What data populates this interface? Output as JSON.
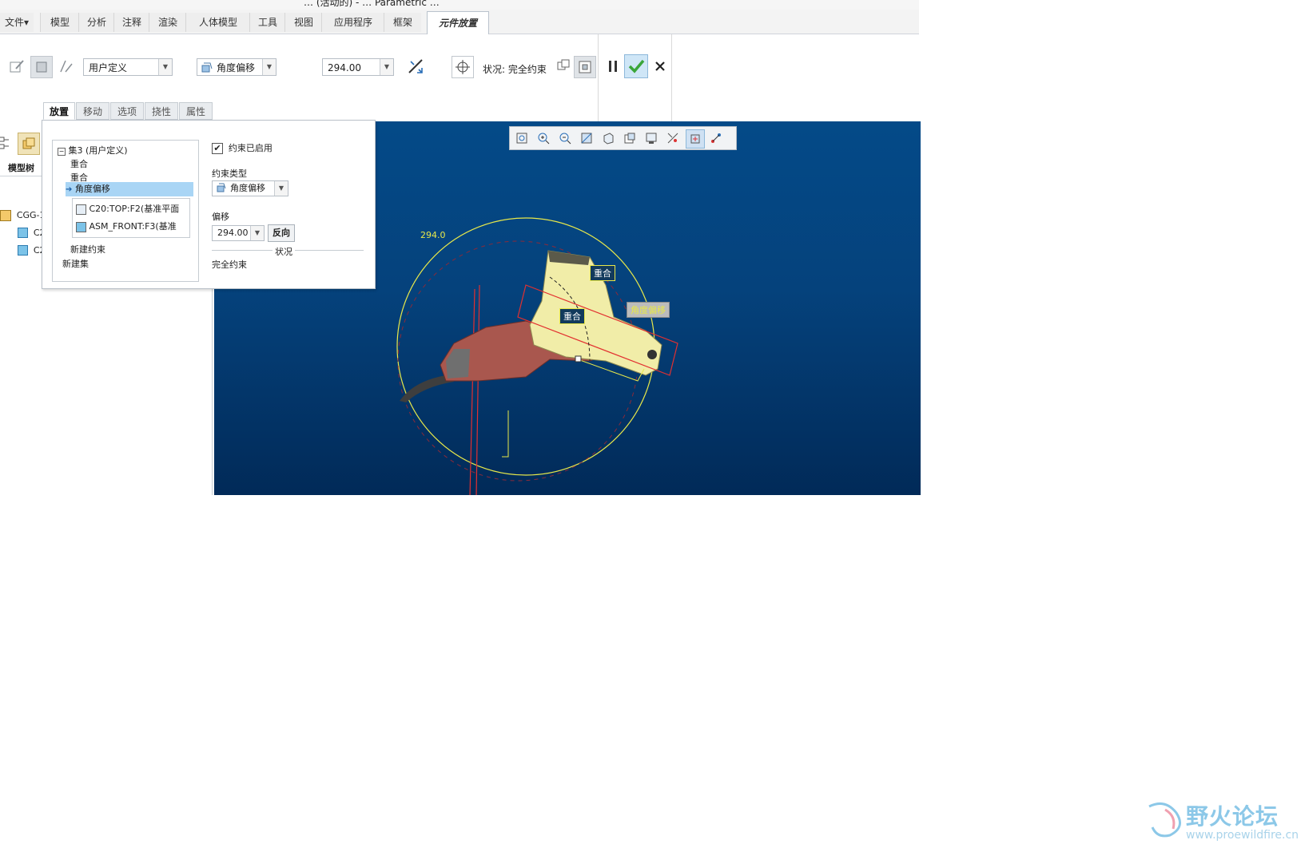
{
  "title_fragment": "… (活动的) - … Parametric …",
  "menu": {
    "items": [
      "文件▾",
      "模型",
      "分析",
      "注释",
      "渲染",
      "人体模型",
      "工具",
      "视图",
      "应用程序",
      "框架",
      "元件放置"
    ],
    "active": "元件放置"
  },
  "ribbon": {
    "set_type": "用户定义",
    "constraint_type": "角度偏移",
    "offset_value": "294.00",
    "status_label": "状况: 完全约束"
  },
  "subtabs": [
    "放置",
    "移动",
    "选项",
    "挠性",
    "属性"
  ],
  "tree": {
    "header": "模型树",
    "items": [
      "CGG-1",
      "C2",
      "C2"
    ]
  },
  "panel": {
    "set_header": "集3 (用户定义)",
    "constraints": [
      "重合",
      "重合",
      "角度偏移"
    ],
    "refs": [
      "C20:TOP:F2(基准平面",
      "ASM_FRONT:F3(基准"
    ],
    "new_constraint": "新建约束",
    "new_set": "新建集",
    "enabled_label": "约束已启用",
    "type_label": "约束类型",
    "type_value": "角度偏移",
    "offset_label": "偏移",
    "offset_value": "294.00",
    "flip_label": "反向",
    "status_group": "状况",
    "status_value": "完全约束"
  },
  "viewport": {
    "angle_label": "294.0",
    "tag_1": "重合",
    "tag_2": "重合",
    "tag_3": "角度偏移"
  },
  "watermark": {
    "name": "野火论坛",
    "url": "www.proewildfire.cn"
  },
  "colors": {
    "accent_check": "#3aa63a",
    "viewport_top": "#044a88",
    "viewport_bottom": "#012a58",
    "highlight": "#a9d5f5"
  }
}
